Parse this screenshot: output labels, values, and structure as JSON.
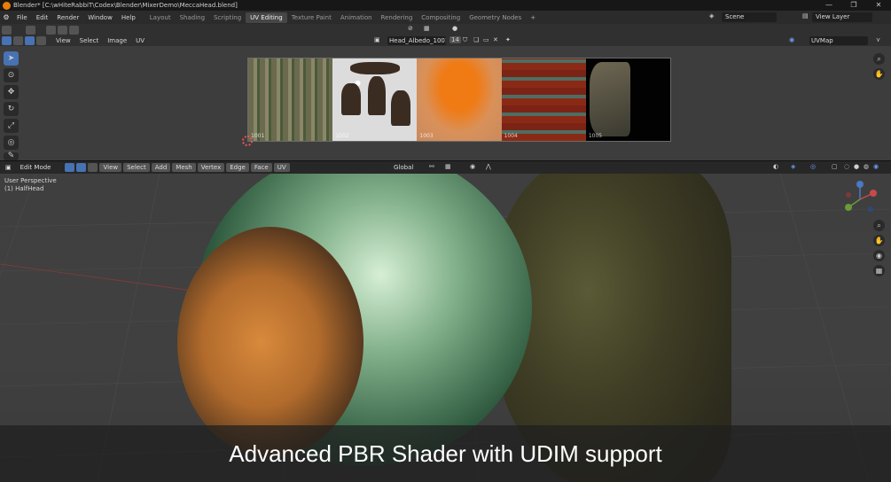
{
  "window": {
    "title": "Blender* [C:\\wHiteRabbiT\\Codex\\Blender\\MixerDemo\\MeccaHead.blend]",
    "minimize": "—",
    "maximize": "❐",
    "close": "✕"
  },
  "menu": {
    "items": [
      "File",
      "Edit",
      "Render",
      "Window",
      "Help"
    ]
  },
  "workspaces": {
    "tabs": [
      "Layout",
      "Shading",
      "Scripting",
      "UV Editing",
      "Texture Paint",
      "Animation",
      "Rendering",
      "Compositing",
      "Geometry Nodes"
    ],
    "active": "UV Editing",
    "add": "+"
  },
  "scene": {
    "name": "Scene"
  },
  "view_layer": {
    "name": "View Layer"
  },
  "uv_editor": {
    "menus": [
      "View",
      "Select",
      "Image",
      "UV"
    ],
    "image_name": "Head_Albedo_1001.png",
    "image_users": "14",
    "uvmap": "UVMap",
    "tiles": [
      "1001",
      "1002",
      "1003",
      "1004",
      "1005"
    ]
  },
  "viewport": {
    "mode": "Edit Mode",
    "menus": [
      "View",
      "Select",
      "Add",
      "Mesh",
      "Vertex",
      "Edge",
      "Face",
      "UV"
    ],
    "orientation": "Global",
    "perspective": "User Perspective",
    "object": "(1) HalfHead"
  },
  "caption": "Advanced PBR Shader with UDIM support",
  "colors": {
    "accent": "#4772b3",
    "active_tab": "#464646",
    "blender_orange": "#e87d0d"
  }
}
